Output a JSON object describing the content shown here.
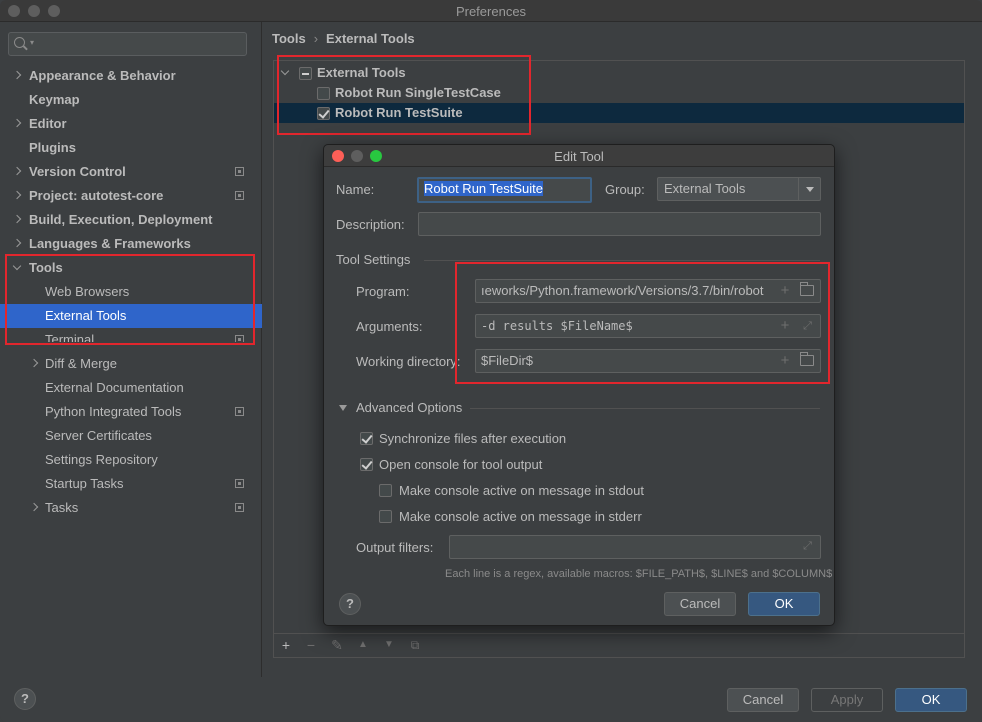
{
  "window": {
    "title": "Preferences"
  },
  "sidebar": {
    "search_placeholder": "",
    "items": [
      {
        "label": "Appearance & Behavior",
        "expandable": true
      },
      {
        "label": "Keymap",
        "expandable": false
      },
      {
        "label": "Editor",
        "expandable": true
      },
      {
        "label": "Plugins",
        "expandable": false
      },
      {
        "label": "Version Control",
        "expandable": true,
        "project": true
      },
      {
        "label": "Project: autotest-core",
        "expandable": true,
        "project": true
      },
      {
        "label": "Build, Execution, Deployment",
        "expandable": true
      },
      {
        "label": "Languages & Frameworks",
        "expandable": true
      },
      {
        "label": "Tools",
        "expanded": true
      },
      {
        "label": "Web Browsers"
      },
      {
        "label": "External Tools",
        "selected": true
      },
      {
        "label": "Terminal",
        "project": true
      },
      {
        "label": "Diff & Merge",
        "expandable": true
      },
      {
        "label": "External Documentation"
      },
      {
        "label": "Python Integrated Tools",
        "project": true
      },
      {
        "label": "Server Certificates"
      },
      {
        "label": "Settings Repository"
      },
      {
        "label": "Startup Tasks",
        "project": true
      },
      {
        "label": "Tasks",
        "expandable": true,
        "project": true
      }
    ]
  },
  "breadcrumb": {
    "parent": "Tools",
    "current": "External Tools"
  },
  "tools_tree": {
    "group": "External Tools",
    "items": [
      {
        "label": "Robot Run SingleTestCase",
        "checked": false
      },
      {
        "label": "Robot Run TestSuite",
        "checked": true,
        "selected": true
      }
    ]
  },
  "edit_tool": {
    "title": "Edit Tool",
    "name_label": "Name:",
    "name_value": "Robot Run TestSuite",
    "group_label": "Group:",
    "group_value": "External Tools",
    "description_label": "Description:",
    "description_value": "",
    "tool_settings_label": "Tool Settings",
    "program_label": "Program:",
    "program_value": "ıeworks/Python.framework/Versions/3.7/bin/robot",
    "arguments_label": "Arguments:",
    "arguments_value": "-d results $FileName$",
    "working_dir_label": "Working directory:",
    "working_dir_value": "$FileDir$",
    "advanced_label": "Advanced Options",
    "sync_label": "Synchronize files after execution",
    "sync_checked": true,
    "console_label": "Open console for tool output",
    "console_checked": true,
    "stdout_label": "Make console active on message in stdout",
    "stdout_checked": false,
    "stderr_label": "Make console active on message in stderr",
    "stderr_checked": false,
    "output_filters_label": "Output filters:",
    "output_filters_value": "",
    "hint": "Each line is a regex, available macros: $FILE_PATH$, $LINE$ and $COLUMN$",
    "cancel": "Cancel",
    "ok": "OK"
  },
  "footer": {
    "cancel": "Cancel",
    "apply": "Apply",
    "ok": "OK"
  },
  "colors": {
    "selection": "#2f65ca",
    "annotation_red": "#e2262d",
    "primary_button": "#365880"
  }
}
